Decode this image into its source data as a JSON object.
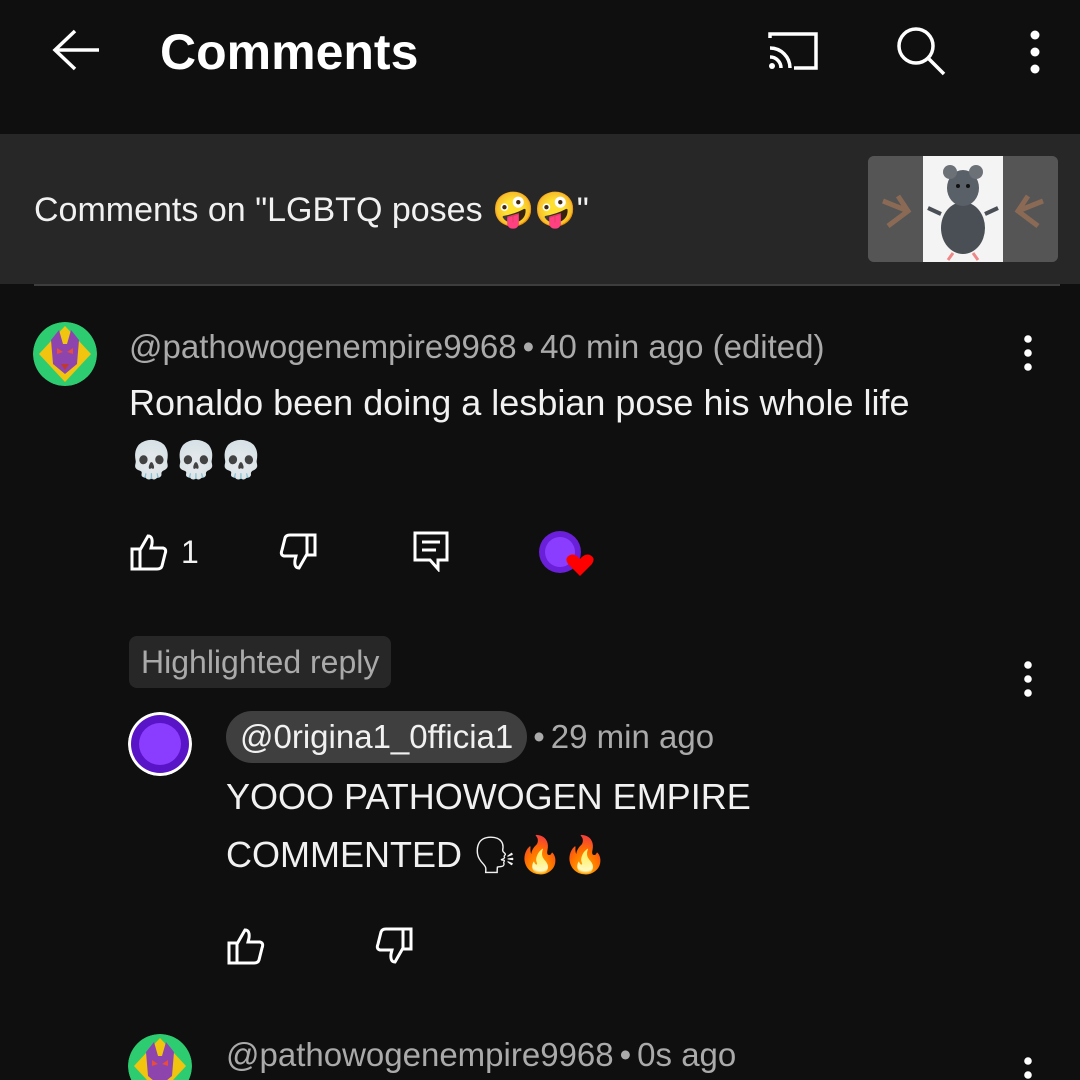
{
  "header": {
    "title": "Comments",
    "back_icon": "arrow-left-icon",
    "cast_icon": "cast-icon",
    "search_icon": "search-icon",
    "more_icon": "more-vertical-icon"
  },
  "video": {
    "title_prefix": "Comments on \"LGBTQ poses ",
    "title_emojis": "🤪🤪",
    "title_suffix": "\""
  },
  "comments": [
    {
      "handle": "@pathowogenempire9968",
      "time": "40 min ago (edited)",
      "text_line1": "Ronaldo been doing a lesbian pose his whole life",
      "text_line2": "💀💀💀",
      "likes": "1",
      "hearted": true
    }
  ],
  "highlighted": {
    "badge": "Highlighted reply",
    "reply": {
      "handle": "@0rigina1_0fficia1",
      "time": "29 min ago",
      "text_line1": "YOOO PATHOWOGEN EMPIRE",
      "text_line2": "COMMENTED",
      "text_emojis": "🗣🔥🔥"
    }
  },
  "next_comment": {
    "handle": "@pathowogenempire9968",
    "time": "0s ago"
  },
  "colors": {
    "background": "#0f0f0f",
    "strip": "#272727",
    "secondary_text": "#aaaaaa",
    "heart": "#ff0000",
    "purple_avatar": "#7b2ff7"
  }
}
